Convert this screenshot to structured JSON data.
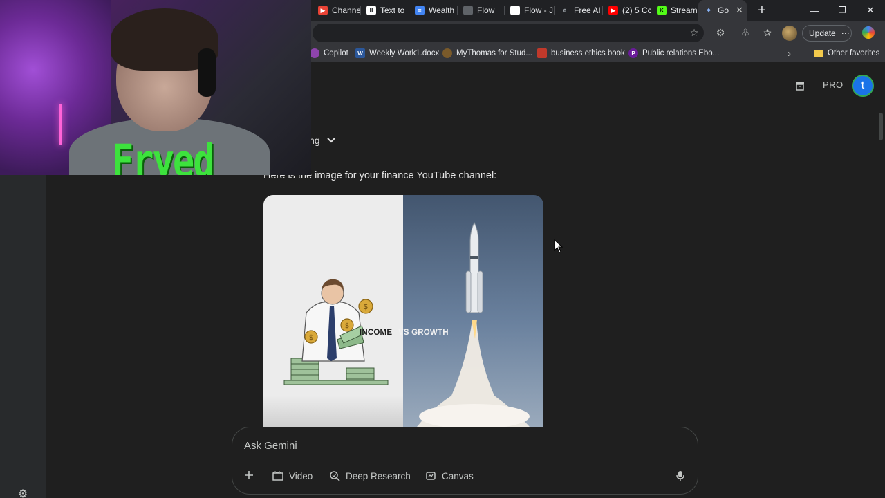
{
  "browser": {
    "tabs": [
      {
        "label": "Channe",
        "favicon_color": "#ea4335",
        "favicon_glyph": "▶"
      },
      {
        "label": "Text to",
        "favicon_color": "#ffffff",
        "favicon_glyph": "II"
      },
      {
        "label": "Wealth",
        "favicon_color": "#4285f4",
        "favicon_glyph": "≡"
      },
      {
        "label": "Flow",
        "favicon_color": "#5f6368",
        "favicon_glyph": "▭"
      },
      {
        "label": "Flow - J",
        "favicon_color": "#ffffff",
        "favicon_glyph": ""
      },
      {
        "label": "Free AI",
        "favicon_color": "#5f6368",
        "favicon_glyph": "⌕"
      },
      {
        "label": "(2) 5 Cc",
        "favicon_color": "#ff0000",
        "favicon_glyph": "▶"
      },
      {
        "label": "Stream",
        "favicon_color": "#53fc18",
        "favicon_glyph": "K"
      },
      {
        "label": "Go",
        "favicon_color": "#8ab4f8",
        "favicon_glyph": "✦",
        "active": true
      }
    ],
    "new_tab_glyph": "+",
    "window_controls": {
      "minimize": "—",
      "restore": "❐",
      "close": "✕"
    },
    "update_label": "Update",
    "update_more": "⋯",
    "bookmarks": [
      {
        "label": "Copilot",
        "icon_color": "#8e44ad"
      },
      {
        "label": "Weekly Work1.docx",
        "icon_color": "#2b579a",
        "glyph": "W"
      },
      {
        "label": "MyThomas for Stud...",
        "icon_color": "#7a5a2a"
      },
      {
        "label": "business ethics book",
        "icon_color": "#c0392b"
      },
      {
        "label": "Public relations Ebo...",
        "icon_color": "#6a1b9a",
        "glyph": "P"
      }
    ],
    "bookmarks_overflow": "›",
    "other_favorites": "Other favorites"
  },
  "gemini": {
    "plan_label": "PRO",
    "user_initial": "t",
    "thinking_label": "ng",
    "response_text": "Here is the image for your finance YouTube channel:",
    "image": {
      "caption_left": "INCOME",
      "caption_right": "VS GROWTH"
    },
    "prompt": {
      "placeholder": "Ask Gemini",
      "tools": [
        "Video",
        "Deep Research",
        "Canvas"
      ]
    }
  },
  "webcam": {
    "overlay_name": "Fryed"
  },
  "colors": {
    "page_bg": "#1f1f1f",
    "rail_bg": "#282a2c",
    "chrome_bg": "#35363a",
    "tabbar_bg": "#202124",
    "accent_avatar": "#1a73e8",
    "overlay_green": "#3de23d"
  }
}
